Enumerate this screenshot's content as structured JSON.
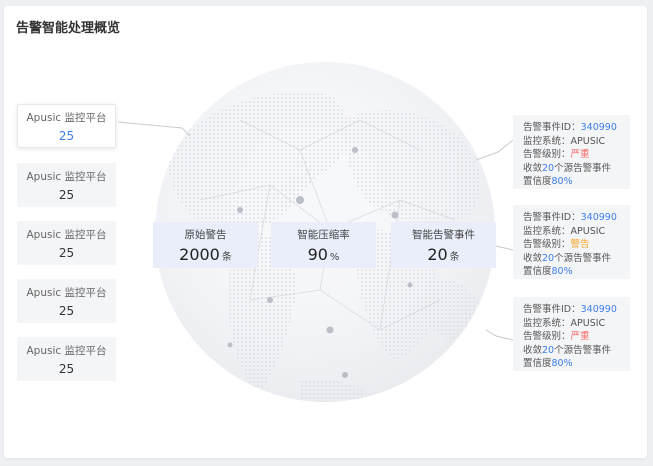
{
  "header": {
    "title": "告警智能处理概览"
  },
  "sources": [
    {
      "name": "Apusic 监控平台",
      "count": "25",
      "active": true
    },
    {
      "name": "Apusic 监控平台",
      "count": "25",
      "active": false
    },
    {
      "name": "Apusic 监控平台",
      "count": "25",
      "active": false
    },
    {
      "name": "Apusic 监控平台",
      "count": "25",
      "active": false
    },
    {
      "name": "Apusic 监控平台",
      "count": "25",
      "active": false
    }
  ],
  "metrics": [
    {
      "label": "原始警告",
      "value": "2000",
      "unit": "条"
    },
    {
      "label": "智能压缩率",
      "value": "90",
      "unit": "%"
    },
    {
      "label": "智能告警事件",
      "value": "20",
      "unit": "条"
    }
  ],
  "alert_labels": {
    "event_id": "告警事件ID：",
    "system": "监控系统：",
    "level": "告警级别：",
    "collect_prefix": "收敛",
    "collect_suffix": "个源告警事件",
    "confidence": "置信度"
  },
  "alerts": [
    {
      "event_id": "340990",
      "system": "APUSIC",
      "level": "严重",
      "level_color": "#f56b6b",
      "collected": "20",
      "confidence": "80%"
    },
    {
      "event_id": "340990",
      "system": "APUSIC",
      "level": "警告",
      "level_color": "#f5a524",
      "collected": "20",
      "confidence": "80%"
    },
    {
      "event_id": "340990",
      "system": "APUSIC",
      "level": "严重",
      "level_color": "#f56b6b",
      "collected": "20",
      "confidence": "80%"
    }
  ],
  "colors": {
    "accent": "#3d7eea",
    "severe": "#f56b6b",
    "warning": "#f5a524"
  }
}
